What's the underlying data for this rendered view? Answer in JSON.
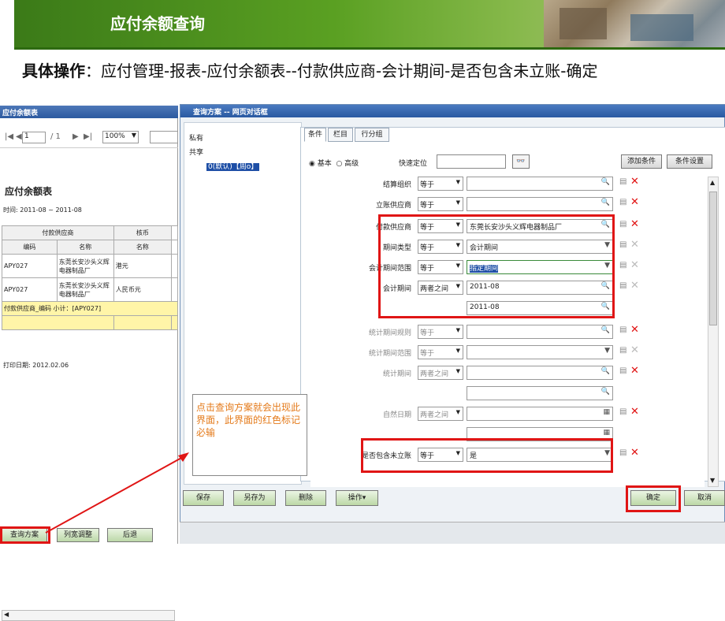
{
  "banner": {
    "title": "应付余额查询"
  },
  "instruction": {
    "bold": "具体操作",
    "text": "：应付管理-报表-应付余额表--付款供应商-会计期间-是否包含未立账-确定"
  },
  "report": {
    "window_title": "应付余额表",
    "page_first": "|◀",
    "page_prev": "◀",
    "page_current": "1",
    "page_total": "/ 1",
    "page_next": "▶",
    "page_last": "▶|",
    "zoom": "100%",
    "heading": "应付余额表",
    "period": "时间: 2011-08 ~ 2011-08",
    "header_group": "付款供应商",
    "header_currency": "核币",
    "col_code": "编码",
    "col_name": "名称",
    "col_currency_name": "名称",
    "rows": [
      {
        "code": "APY027",
        "name": "东莞长安沙头义辉电器制品厂",
        "currency": "港元"
      },
      {
        "code": "APY027",
        "name": "东莞长安沙头义辉电器制品厂",
        "currency": "人民币元"
      }
    ],
    "subtotal": "付款供应商_编码 小计：[APY027]",
    "print_date": "打印日期: 2012.02.06",
    "scroll_arrow": "◀",
    "btn_query": "查询方案",
    "btn_colwidth": "列宽调整",
    "btn_back": "后退"
  },
  "dialog": {
    "title": "查询方案 -- 网页对话框",
    "tree_private": "私有",
    "tree_shared": "共享",
    "tree_default": "0(默认)【周o】",
    "tab_conditions": "条件",
    "tab_columns": "栏目",
    "tab_rowgroup": "行分组",
    "mode_basic": "◉ 基本",
    "mode_advanced": "○ 高级",
    "locate_label": "快速定位",
    "locate_btn": "👓",
    "btn_add_condition": "添加条件",
    "btn_condition_settings": "条件设置",
    "conditions": [
      {
        "label": "结算组织",
        "op": "等于",
        "value": "",
        "icon": "🔍",
        "dim": false
      },
      {
        "label": "立账供应商",
        "op": "等于",
        "value": "",
        "icon": "🔍",
        "dim": false
      },
      {
        "label": "付款供应商",
        "op": "等于",
        "value": "东莞长安沙头义辉电器制品厂",
        "icon": "🔍",
        "dim": false
      },
      {
        "label": "期间类型",
        "op": "等于",
        "value": "会计期间",
        "icon": "▼",
        "dim": false
      },
      {
        "label": "会计期间范围",
        "op": "等于",
        "value": "指定期间",
        "icon": "▼",
        "dim": false
      },
      {
        "label": "会计期间",
        "op": "两者之间",
        "value": "2011-08",
        "icon": "🔍",
        "dim": false
      },
      {
        "label": "",
        "op": "",
        "value": "2011-08",
        "icon": "🔍",
        "dim": false
      },
      {
        "label": "统计期间规则",
        "op": "等于",
        "value": "",
        "icon": "🔍",
        "dim": true
      },
      {
        "label": "统计期间范围",
        "op": "等于",
        "value": "",
        "icon": "▼",
        "dim": true
      },
      {
        "label": "统计期间",
        "op": "两者之间",
        "value": "",
        "icon": "🔍",
        "dim": true
      },
      {
        "label": "",
        "op": "",
        "value": "",
        "icon": "🔍",
        "dim": true
      },
      {
        "label": "自然日期",
        "op": "两者之间",
        "value": "",
        "icon": "▦",
        "dim": true
      },
      {
        "label": "",
        "op": "",
        "value": "",
        "icon": "▦",
        "dim": true
      },
      {
        "label": "是否包含未立账",
        "op": "等于",
        "value": "是",
        "icon": "▼",
        "dim": false
      }
    ],
    "callout": "点击查询方案就会出现此界面，此界面的红色标记必输",
    "btn_save": "保存",
    "btn_save_as": "另存为",
    "btn_delete": "删除",
    "btn_operations": "操作▾",
    "btn_ok": "确定",
    "btn_cancel": "取消"
  },
  "colors": {
    "accent_red": "#e01515",
    "title_blue": "#2c5aa0",
    "banner_green": "#5aa022"
  }
}
